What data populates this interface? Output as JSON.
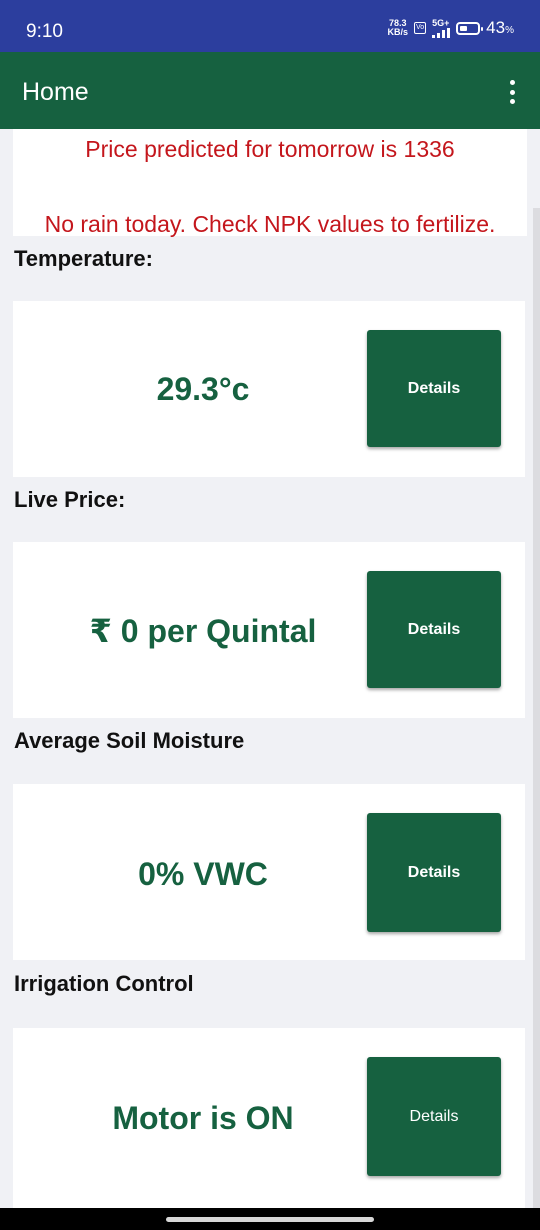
{
  "status_bar": {
    "time": "9:10",
    "net_speed_top": "78.3",
    "net_speed_bottom": "KB/s",
    "volte_badge": "Vo",
    "network_type": "5G+",
    "battery_percent": "43",
    "battery_unit": "%",
    "battery_level": 0.43
  },
  "app_bar": {
    "title": "Home",
    "menu_icon": "more-vert-icon"
  },
  "notices": {
    "price_prediction": "Price predicted for tomorrow is 1336",
    "rain_advice": "No rain today. Check NPK values to fertilize."
  },
  "sections": {
    "temperature": {
      "label": "Temperature:",
      "value": "29.3°c",
      "button": "Details"
    },
    "live_price": {
      "label": "Live Price:",
      "value": "₹ 0 per Quintal",
      "button": "Details"
    },
    "soil_moisture": {
      "label": "Average Soil Moisture",
      "value": "0% VWC",
      "button": "Details"
    },
    "irrigation": {
      "label": "Irrigation Control",
      "value": "Motor is ON",
      "button": "Details"
    }
  },
  "colors": {
    "status_bar": "#2c3e9e",
    "app_bar": "#166140",
    "accent_text": "#166140",
    "alert_text": "#c4161c",
    "background": "#f0f1f5"
  }
}
